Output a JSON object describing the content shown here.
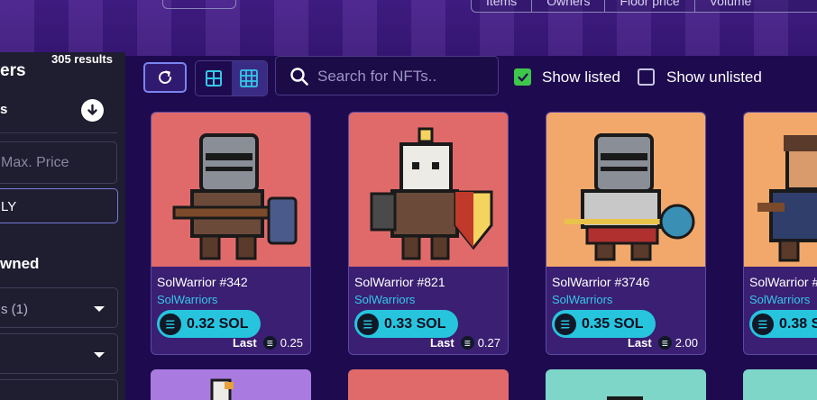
{
  "header": {
    "stats": [
      "Items",
      "Owners",
      "Floor price",
      "Volume"
    ]
  },
  "sidebar": {
    "title": "ers",
    "results": "305 results",
    "row1_label": "s",
    "max_price_placeholder": "Max. Price",
    "currency_value": "LY",
    "section_label": "wned",
    "select1_value": "s (1)",
    "select2_value": ""
  },
  "toolbar": {
    "search_placeholder": "Search for NFTs..",
    "show_listed_label": "Show listed",
    "show_listed_checked": true,
    "show_unlisted_label": "Show unlisted",
    "show_unlisted_checked": false
  },
  "cards": [
    {
      "name": "SolWarrior #342",
      "collection": "SolWarriors",
      "price": "0.32 SOL",
      "last_label": "Last",
      "last_value": "0.25",
      "bg": "#e06a6a"
    },
    {
      "name": "SolWarrior #821",
      "collection": "SolWarriors",
      "price": "0.33 SOL",
      "last_label": "Last",
      "last_value": "0.27",
      "bg": "#e06a6a"
    },
    {
      "name": "SolWarrior #3746",
      "collection": "SolWarriors",
      "price": "0.35 SOL",
      "last_label": "Last",
      "last_value": "2.00",
      "bg": "#f2a86a"
    },
    {
      "name": "SolWarrior #",
      "collection": "SolWarriors",
      "price": "0.38 S",
      "last_label": "",
      "last_value": "",
      "bg": "#f2a86a"
    }
  ],
  "colors": {
    "accent": "#27c4de",
    "collection_link": "#35c8e8",
    "checkbox_on": "#3ec74a",
    "background": "#1e0b4f"
  }
}
